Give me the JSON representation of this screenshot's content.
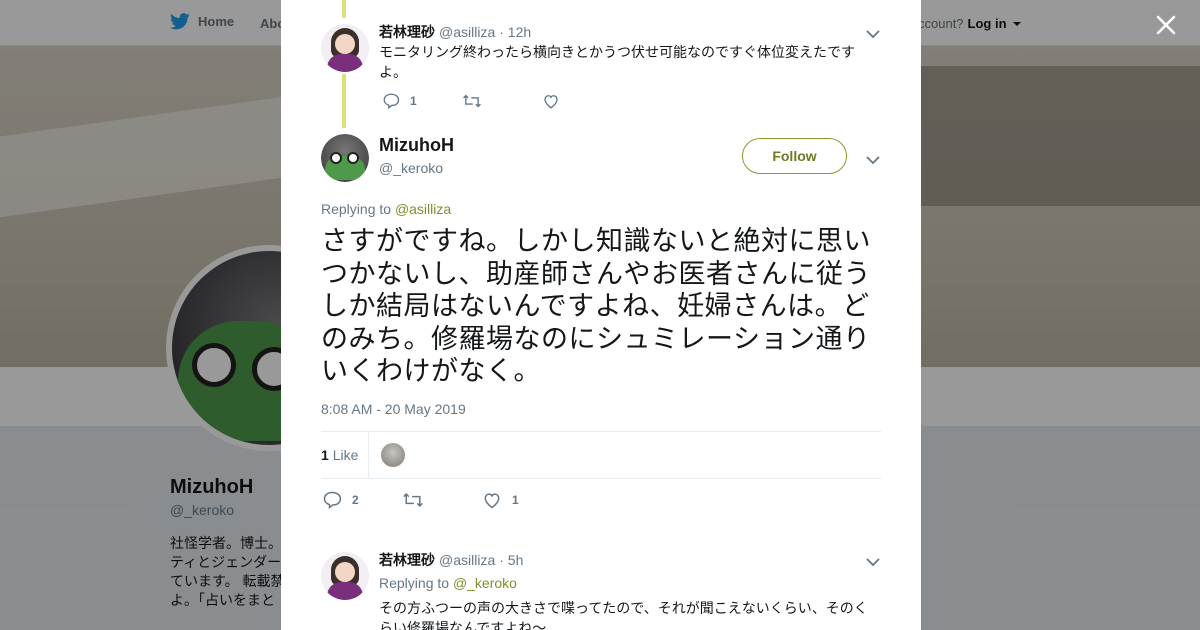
{
  "topbar": {
    "home_label": "Home",
    "about_label": "Abo",
    "account_prompt": "ccount?",
    "login_label": "Log in"
  },
  "profile": {
    "name": "MizuhoH",
    "handle": "@_keroko",
    "bio": "社怪学者。博士。ティとジェンダーています。 転載禁よ。「占いをまと"
  },
  "tweets": [
    {
      "display_name": "若林理砂",
      "username": "@asilliza",
      "time": "· 12h",
      "text": "モニタリング終わったら横向きとかうつ伏せ可能なのですぐ体位変えたですよ。",
      "replies": "1",
      "retweets": "",
      "likes": ""
    },
    {
      "display_name": "若林理砂",
      "username": "@asilliza",
      "time": "· 5h",
      "replying_prefix": "Replying to",
      "replying_to": "@_keroko",
      "text": "その方ふつーの声の大きさで喋ってたので、それが聞こえないくらい、そのくらい修羅場なんですよね〜"
    }
  ],
  "main_tweet": {
    "display_name": "MizuhoH",
    "username": "@_keroko",
    "follow_label": "Follow",
    "replying_prefix": "Replying to",
    "replying_to": "@asilliza",
    "text": "さすがですね。しかし知識ないと絶対に思いつかないし、助産師さんやお医者さんに従うしか結局はないんですよね、妊婦さんは。どのみち。修羅場なのにシュミレーション通りいくわけがなく。",
    "timestamp": "8:08 AM - 20 May 2019",
    "like_count": "1",
    "like_label": "Like",
    "replies": "2",
    "retweets": "",
    "likes": "1"
  },
  "colors": {
    "accent": "#7f8f2a",
    "thread_line": "#cfd84e",
    "twitter_blue": "#1da1f2",
    "text_secondary": "#657786"
  },
  "icons": [
    "twitter-bird-icon",
    "close-icon",
    "chevron-down-icon",
    "reply-icon",
    "retweet-icon",
    "heart-icon"
  ]
}
